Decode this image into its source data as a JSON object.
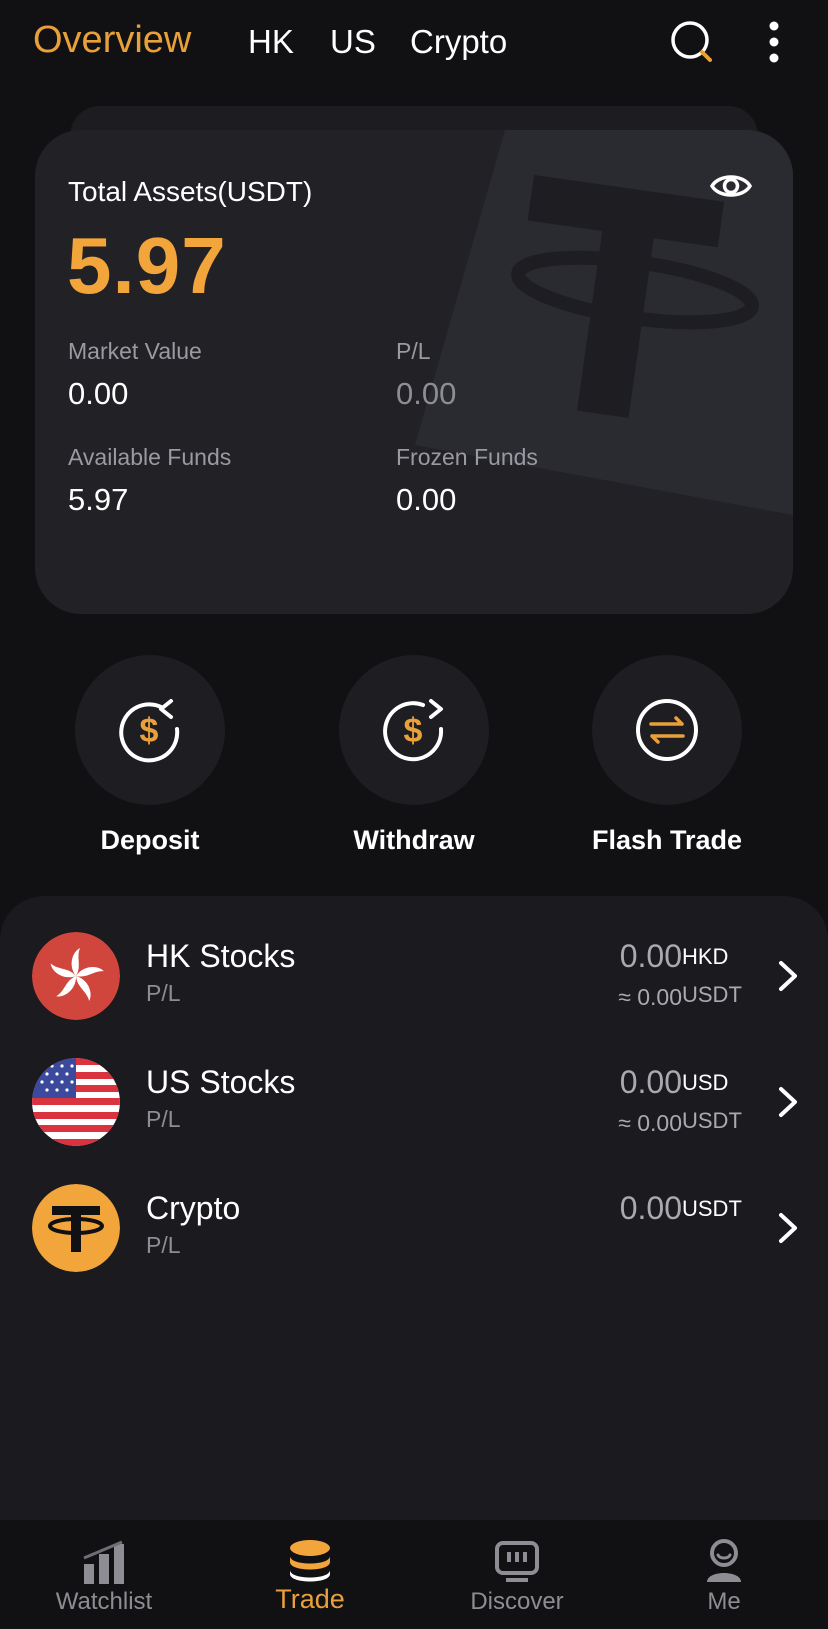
{
  "topnav": {
    "tabs": [
      "Overview",
      "HK",
      "US",
      "Crypto"
    ],
    "active": "Overview",
    "search_icon": "search-icon",
    "more_icon": "more-vertical-icon"
  },
  "summary": {
    "title": "Total Assets(USDT)",
    "total": "5.97",
    "eye_icon": "eye-icon",
    "market_value_label": "Market Value",
    "market_value": "0.00",
    "pl_label": "P/L",
    "pl": "0.00",
    "available_label": "Available Funds",
    "available": "5.97",
    "frozen_label": "Frozen Funds",
    "frozen": "0.00"
  },
  "actions": [
    {
      "label": "Deposit",
      "icon": "deposit-icon"
    },
    {
      "label": "Withdraw",
      "icon": "withdraw-icon"
    },
    {
      "label": "Flash Trade",
      "icon": "swap-icon"
    }
  ],
  "accounts": [
    {
      "name": "HK Stocks",
      "sub": "P/L",
      "amount": "0.00",
      "currency": "HKD",
      "approx": "≈ 0.00",
      "approx_currency": "USDT",
      "icon": "hk-flag-icon"
    },
    {
      "name": "US Stocks",
      "sub": "P/L",
      "amount": "0.00",
      "currency": "USD",
      "approx": "≈ 0.00",
      "approx_currency": "USDT",
      "icon": "us-flag-icon"
    },
    {
      "name": "Crypto",
      "sub": "P/L",
      "amount": "0.00",
      "currency": "USDT",
      "icon": "tether-icon"
    }
  ],
  "bottomnav": {
    "items": [
      {
        "label": "Watchlist",
        "icon": "bar-chart-icon"
      },
      {
        "label": "Trade",
        "icon": "coins-stack-icon"
      },
      {
        "label": "Discover",
        "icon": "monitor-icon"
      },
      {
        "label": "Me",
        "icon": "person-icon"
      }
    ],
    "active": "Trade"
  },
  "colors": {
    "accent": "#e8a13a",
    "background": "#111114",
    "card": "#212126",
    "muted": "#8d8d93"
  }
}
